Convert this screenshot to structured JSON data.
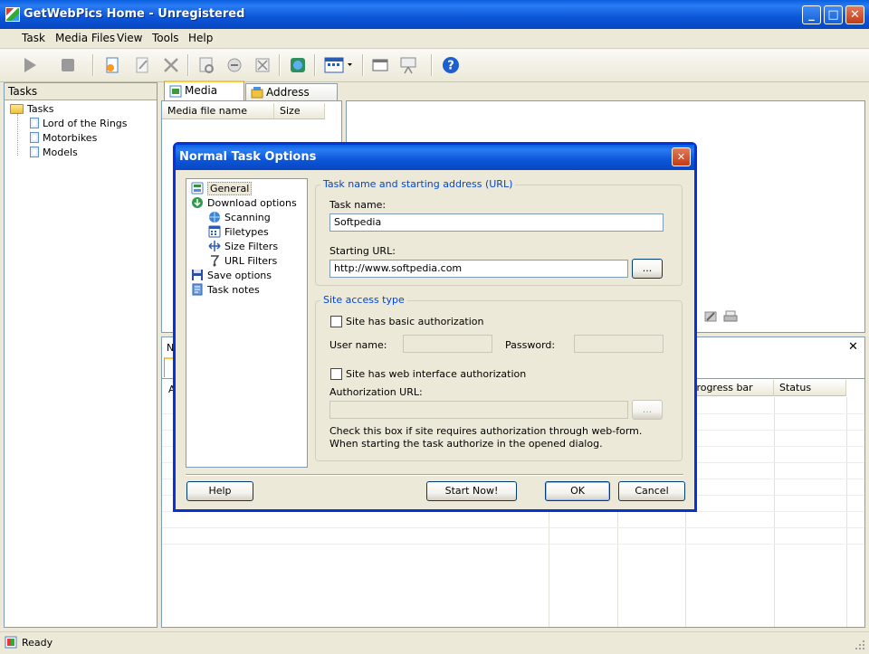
{
  "window": {
    "title": "GetWebPics Home - Unregistered",
    "min": "_",
    "max": "□",
    "close": "✕"
  },
  "menu": [
    "Task",
    "Media Files",
    "View",
    "Tools",
    "Help"
  ],
  "left_panel": {
    "header": "Tasks",
    "root": "Tasks",
    "items": [
      "Lord of the Rings",
      "Motorbikes",
      "Models"
    ]
  },
  "tabs": [
    "Media Files",
    "Address Queue"
  ],
  "media_table": {
    "columns": [
      "Media file name",
      "Size"
    ]
  },
  "lower_table": {
    "columns_visible": [
      "Progress bar",
      "Status"
    ],
    "partial_header": "N",
    "partial_col": "A"
  },
  "status": {
    "text": "Ready"
  },
  "dialog": {
    "title": "Normal Task Options",
    "close": "✕",
    "tree": [
      {
        "label": "General",
        "level": 0
      },
      {
        "label": "Download options",
        "level": 0
      },
      {
        "label": "Scanning",
        "level": 1
      },
      {
        "label": "Filetypes",
        "level": 1
      },
      {
        "label": "Size Filters",
        "level": 1
      },
      {
        "label": "URL Filters",
        "level": 1
      },
      {
        "label": "Save options",
        "level": 0
      },
      {
        "label": "Task notes",
        "level": 0
      }
    ],
    "group1": {
      "title": "Task name and starting address (URL)",
      "task_name_label": "Task name:",
      "task_name_value": "Softpedia",
      "url_label": "Starting URL:",
      "url_value": "http://www.softpedia.com",
      "browse": "..."
    },
    "group2": {
      "title": "Site access type",
      "basic_auth": "Site has basic authorization",
      "user_label": "User name:",
      "pass_label": "Password:",
      "web_auth": "Site has web interface authorization",
      "auth_url_label": "Authorization URL:",
      "browse": "...",
      "note": "Check this box if site requires authorization through web-form. When starting the task authorize in the opened dialog."
    },
    "buttons": {
      "help": "Help",
      "start": "Start Now!",
      "ok": "OK",
      "cancel": "Cancel"
    }
  },
  "colors": {
    "title_blue": "#0A5FE0",
    "group_label": "#0046D5",
    "xp_face": "#ECE9D8"
  }
}
